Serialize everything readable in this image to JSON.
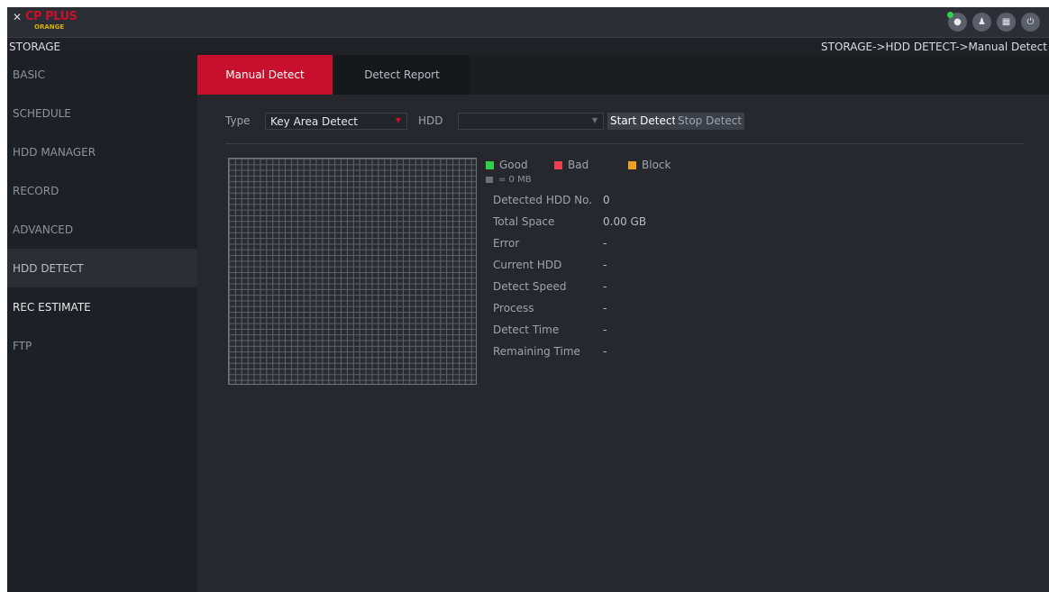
{
  "app": {
    "logo_mark": "✕",
    "logo_text": "CP PLUS",
    "logo_sub": "ORANGE",
    "icons": [
      "eye-icon",
      "user-icon",
      "grid-icon",
      "power-icon"
    ]
  },
  "header": {
    "title": "STORAGE",
    "breadcrumb": "STORAGE->HDD DETECT->Manual Detect"
  },
  "sidebar": {
    "items": [
      {
        "label": "BASIC"
      },
      {
        "label": "SCHEDULE"
      },
      {
        "label": "HDD MANAGER"
      },
      {
        "label": "RECORD"
      },
      {
        "label": "ADVANCED"
      },
      {
        "label": "HDD DETECT"
      },
      {
        "label": "REC ESTIMATE"
      },
      {
        "label": "FTP"
      }
    ]
  },
  "tabs": [
    {
      "label": "Manual Detect"
    },
    {
      "label": "Detect Report"
    }
  ],
  "toolbar": {
    "type_label": "Type",
    "type_value": "Key Area Detect",
    "hdd_label": "HDD",
    "hdd_value": "",
    "start_label": "Start Detect",
    "stop_label": "Stop Detect"
  },
  "legend": {
    "good": "Good",
    "bad": "Bad",
    "block": "Block",
    "unit": "= 0 MB",
    "colors": {
      "good": "#2fd14a",
      "bad": "#e8414f",
      "block": "#f0a020",
      "unit": "#6b707a"
    }
  },
  "info": [
    {
      "label": "Detected HDD No.",
      "value": "0"
    },
    {
      "label": "Total Space",
      "value": "0.00 GB"
    },
    {
      "label": "Error",
      "value": "-"
    },
    {
      "label": "Current HDD",
      "value": "-"
    },
    {
      "label": "Detect Speed",
      "value": "-"
    },
    {
      "label": "Process",
      "value": "-"
    },
    {
      "label": "Detect Time",
      "value": "-"
    },
    {
      "label": "Remaining Time",
      "value": "-"
    }
  ]
}
